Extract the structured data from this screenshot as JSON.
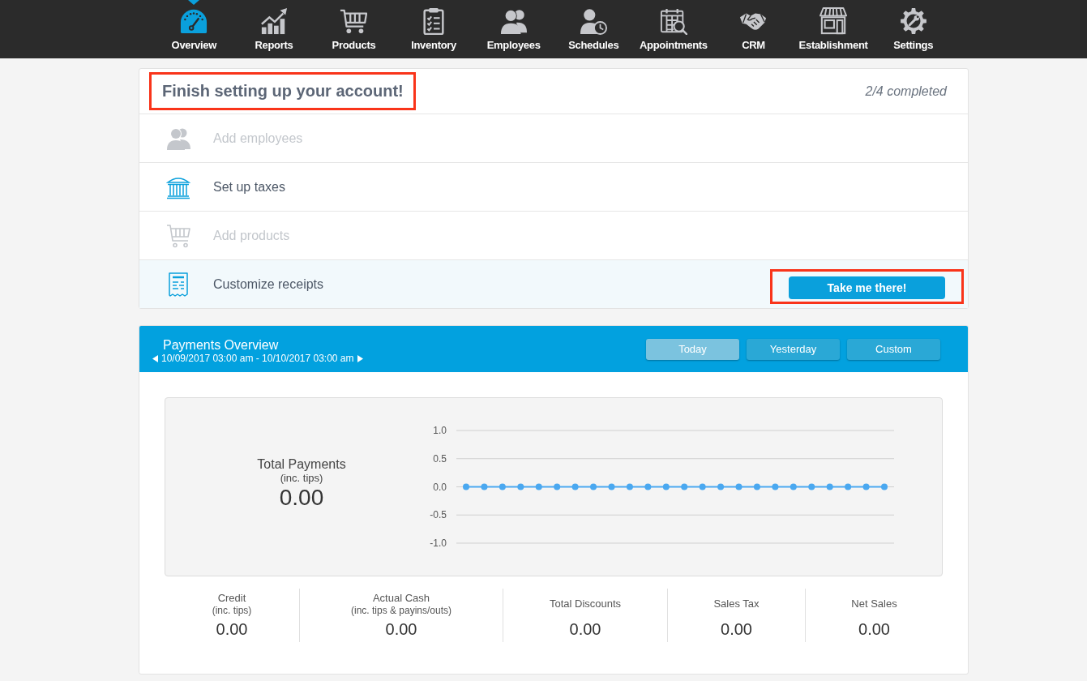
{
  "nav": [
    {
      "label": "Overview",
      "selected": true
    },
    {
      "label": "Reports",
      "selected": false
    },
    {
      "label": "Products",
      "selected": false
    },
    {
      "label": "Inventory",
      "selected": false
    },
    {
      "label": "Employees",
      "selected": false
    },
    {
      "label": "Schedules",
      "selected": false
    },
    {
      "label": "Appointments",
      "selected": false
    },
    {
      "label": "CRM",
      "selected": false
    },
    {
      "label": "Establishment",
      "selected": false
    },
    {
      "label": "Settings",
      "selected": false
    }
  ],
  "setup": {
    "title": "Finish setting up your account!",
    "highlighted": true,
    "progress": "2/4 completed",
    "tasks": [
      {
        "label": "Add employees",
        "completed": true,
        "selected": false
      },
      {
        "label": "Set up taxes",
        "completed": false,
        "selected": false
      },
      {
        "label": "Add products",
        "completed": true,
        "selected": false
      },
      {
        "label": "Customize receipts",
        "completed": false,
        "selected": true,
        "button": {
          "label": "Take me there!",
          "highlighted": true
        }
      }
    ]
  },
  "payments": {
    "title": "Payments Overview",
    "date_range": "10/09/2017 03:00 am - 10/10/2017 03:00 am",
    "ranges": [
      {
        "label": "Today",
        "selected": true
      },
      {
        "label": "Yesterday",
        "selected": false
      },
      {
        "label": "Custom",
        "selected": false
      }
    ],
    "total": {
      "label": "Total Payments",
      "sublabel": "(inc. tips)",
      "value": "0.00"
    },
    "chart_data": {
      "type": "line",
      "values": [
        0,
        0,
        0,
        0,
        0,
        0,
        0,
        0,
        0,
        0,
        0,
        0,
        0,
        0,
        0,
        0,
        0,
        0,
        0,
        0,
        0,
        0,
        0,
        0
      ],
      "ylim": [
        -1,
        1
      ],
      "yticks": [
        {
          "value": 1,
          "label": "1.0"
        },
        {
          "value": 0.5,
          "label": "0.5"
        },
        {
          "value": 0,
          "label": "0.0"
        },
        {
          "value": -0.5,
          "label": "-0.5"
        },
        {
          "value": -1,
          "label": "-1.0"
        }
      ],
      "grid": true,
      "marker": "circle"
    },
    "summary": [
      {
        "label": "Credit",
        "sublabel": "(inc. tips)",
        "value": "0.00"
      },
      {
        "label": "Actual Cash",
        "sublabel": "(inc. tips & payins/outs)",
        "value": "0.00"
      },
      {
        "label": "Total Discounts",
        "value": "0.00"
      },
      {
        "label": "Sales Tax",
        "value": "0.00"
      },
      {
        "label": "Net Sales",
        "value": "0.00"
      }
    ]
  }
}
